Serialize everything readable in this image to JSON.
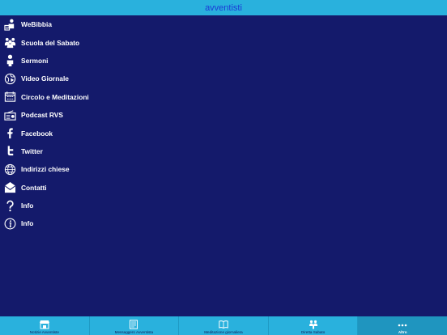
{
  "header": {
    "title": "avventisti"
  },
  "menu": {
    "items": [
      {
        "label": "WeBibbia",
        "icon": "reading-person-icon"
      },
      {
        "label": "Scuola del Sabato",
        "icon": "group-icon"
      },
      {
        "label": "Sermoni",
        "icon": "person-icon"
      },
      {
        "label": "Video Giornale",
        "icon": "globe-play-icon"
      },
      {
        "label": "Circolo e Meditazioni",
        "icon": "calendar-icon"
      },
      {
        "label": "Podcast RVS",
        "icon": "radio-icon"
      },
      {
        "label": "Facebook",
        "icon": "facebook-icon"
      },
      {
        "label": "Twitter",
        "icon": "twitter-icon"
      },
      {
        "label": "Indirizzi chiese",
        "icon": "globe-icon"
      },
      {
        "label": "Contatti",
        "icon": "envelope-icon"
      },
      {
        "label": "Info",
        "icon": "question-icon"
      },
      {
        "label": "Info",
        "icon": "info-icon"
      }
    ]
  },
  "tabbar": {
    "tabs": [
      {
        "label": "Notizie Avventiste",
        "icon": "store-icon"
      },
      {
        "label": "Messaggero Avventista",
        "icon": "document-icon"
      },
      {
        "label": "Meditazione giornaliera",
        "icon": "open-book-icon"
      },
      {
        "label": "Diretta Sabato",
        "icon": "group-icon"
      },
      {
        "label": "Altro",
        "icon": "more-icon"
      }
    ],
    "active_index": 4
  },
  "colors": {
    "background": "#141a6b",
    "bar": "#29b1dd",
    "title": "#1a3bd6"
  }
}
